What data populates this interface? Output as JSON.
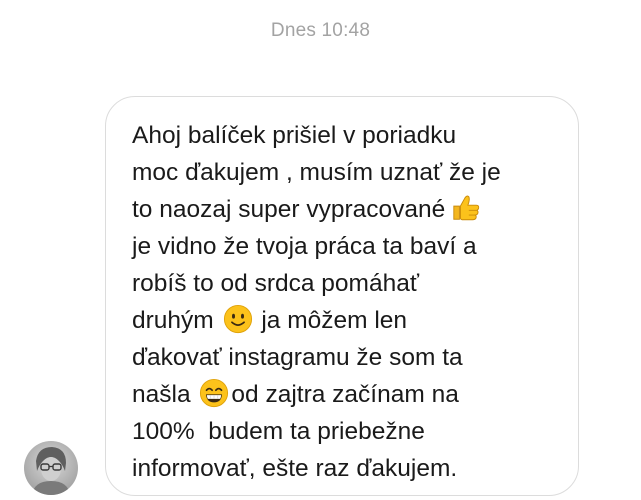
{
  "chat": {
    "timestamp": "Dnes 10:48",
    "message": {
      "lines": [
        {
          "text": "Ahoj balíček prišiel v poriadku"
        },
        {
          "text": "moc ďakujem , musím uznať že je"
        },
        {
          "text": "to naozaj super vypracované",
          "emoji_after": "thumbs-up-icon"
        },
        {
          "text": "je vidno že tvoja práca ta baví a"
        },
        {
          "text": "robíš to od srdca pomáhať"
        },
        {
          "text": "druhým",
          "emoji_after": "slightly-smiling-face-icon",
          "text_after": "ja môžem len"
        },
        {
          "text": "ďakovať instagramu že som ta"
        },
        {
          "text": "našla",
          "emoji_after": "grinning-face-icon",
          "text_after": "od zajtra začínam na"
        },
        {
          "text": "100%  budem ta priebežne"
        },
        {
          "text": "informovať, ešte raz ďakujem."
        }
      ]
    },
    "sender": {
      "avatar_icon": "user-avatar-icon"
    }
  },
  "colors": {
    "timestamp": "#a3a3a3",
    "bubble_border": "#dcdcdc",
    "text": "#1a1a1a",
    "emoji_yellow": "#fcc21b"
  }
}
